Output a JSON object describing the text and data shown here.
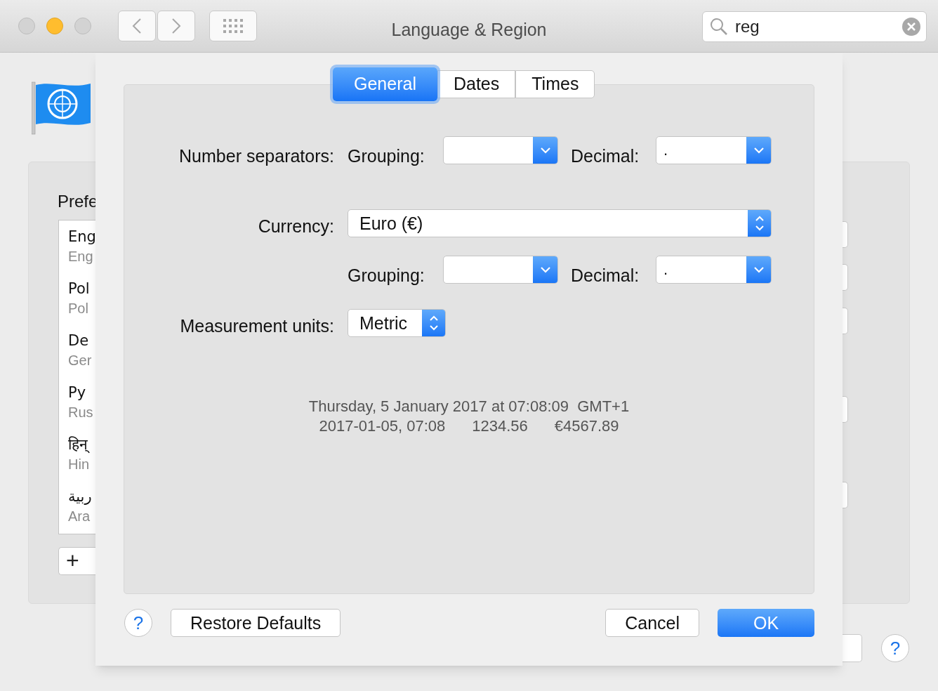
{
  "window": {
    "title": "Language & Region",
    "traffic_lights": [
      {
        "kind": "close",
        "enabled": false
      },
      {
        "kind": "minimize",
        "enabled": true
      },
      {
        "kind": "zoom",
        "enabled": false
      }
    ]
  },
  "toolbar": {
    "search": {
      "value": "reg"
    }
  },
  "background": {
    "heading": "Prefe",
    "languages": [
      {
        "name": "Eng",
        "subtitle": "Eng"
      },
      {
        "name": "Pol",
        "subtitle": "Pol"
      },
      {
        "name": "De",
        "subtitle": "Ger"
      },
      {
        "name": "Ру",
        "subtitle": "Rus"
      },
      {
        "name": "हिन्",
        "subtitle": "Hin"
      },
      {
        "name": "ربية",
        "subtitle": "Ara"
      }
    ],
    "add_button": "+",
    "help_button": "?"
  },
  "sheet": {
    "tabs": [
      {
        "label": "General",
        "selected": true
      },
      {
        "label": "Dates",
        "selected": false
      },
      {
        "label": "Times",
        "selected": false
      }
    ],
    "number_separators": {
      "label": "Number separators:",
      "grouping_label": "Grouping:",
      "decimal_label": "Decimal:",
      "decimal_value": "."
    },
    "currency": {
      "label": "Currency:",
      "value": "Euro (€)",
      "grouping_label": "Grouping:",
      "decimal_label": "Decimal:",
      "decimal_value": "."
    },
    "measurement": {
      "label": "Measurement units:",
      "value": "Metric"
    },
    "sample": {
      "line_1": "Thursday, 5 January 2017 at 07:08:09  GMT+1",
      "line_2": [
        "2017-01-05, 07:08",
        "1234.56",
        "€4567.89"
      ]
    },
    "buttons": [
      {
        "kind": "help",
        "label": "?"
      },
      {
        "kind": "normal",
        "label": "Restore Defaults"
      },
      {
        "kind": "spacer"
      },
      {
        "kind": "normal",
        "label": "Cancel"
      },
      {
        "kind": "default",
        "label": "OK"
      }
    ]
  }
}
